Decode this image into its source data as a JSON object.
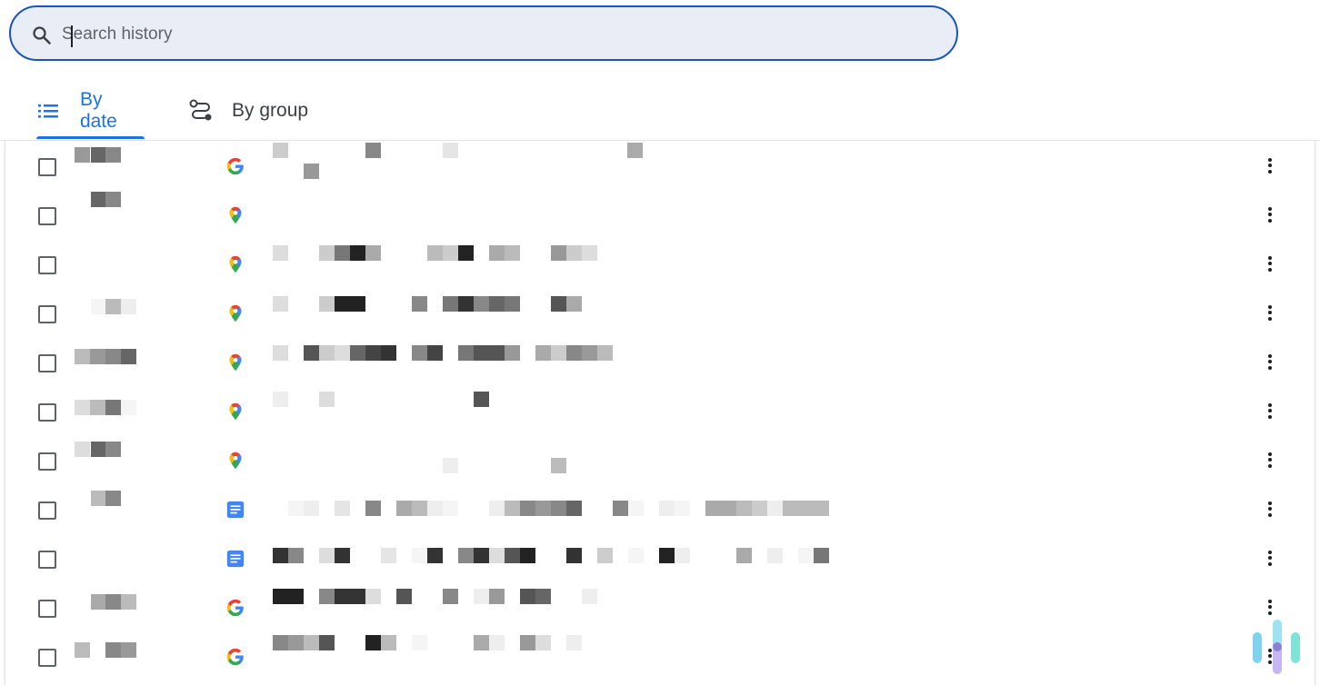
{
  "search": {
    "placeholder": "Search history",
    "icon": "search-icon"
  },
  "tabs": [
    {
      "label": "By date",
      "icon": "list-icon",
      "selected": true
    },
    {
      "label": "By group",
      "icon": "route-icon",
      "selected": false
    }
  ],
  "colors": {
    "accent": "#1a73e8",
    "search_border": "#1a56b8",
    "search_bg": "#e9eef6"
  },
  "rows": [
    {
      "favicon": "google-icon",
      "time_blocks": [
        [
          0,
          8,
          "#999"
        ],
        [
          18,
          8,
          "#666"
        ],
        [
          34,
          8,
          "#888"
        ]
      ],
      "title_blocks": [
        [
          6,
          3,
          "#ccc"
        ],
        [
          40,
          26,
          "#999"
        ],
        [
          108,
          3,
          "#888"
        ],
        [
          193,
          3,
          "#e5e5e5"
        ],
        [
          396,
          3,
          "#aaa"
        ]
      ]
    },
    {
      "favicon": "maps-pin-icon",
      "time_blocks": [
        [
          18,
          3,
          "#666"
        ],
        [
          34,
          3,
          "#888"
        ]
      ],
      "title_blocks": []
    },
    {
      "favicon": "maps-pin-icon",
      "time_blocks": [],
      "title_blocks": [
        [
          6,
          8,
          "#ddd"
        ],
        [
          57,
          8,
          "#ccc"
        ],
        [
          74,
          8,
          "#777"
        ],
        [
          91,
          8,
          "#222"
        ],
        [
          108,
          8,
          "#aaa"
        ],
        [
          176,
          8,
          "#bbb"
        ],
        [
          193,
          8,
          "#ccc"
        ],
        [
          210,
          8,
          "#222"
        ],
        [
          244,
          8,
          "#aaa"
        ],
        [
          261,
          8,
          "#bbb"
        ],
        [
          312,
          8,
          "#999"
        ],
        [
          329,
          8,
          "#ccc"
        ],
        [
          346,
          8,
          "#ddd"
        ]
      ]
    },
    {
      "favicon": "maps-pin-icon",
      "time_blocks": [
        [
          18,
          13,
          "#f5f5f5"
        ],
        [
          34,
          13,
          "#bbb"
        ],
        [
          51,
          13,
          "#eee"
        ]
      ],
      "title_blocks": [
        [
          6,
          10,
          "#ddd"
        ],
        [
          57,
          10,
          "#ccc"
        ],
        [
          74,
          10,
          "#222"
        ],
        [
          91,
          10,
          "#222"
        ],
        [
          159,
          10,
          "#888"
        ],
        [
          193,
          10,
          "#777"
        ],
        [
          210,
          10,
          "#333"
        ],
        [
          227,
          10,
          "#888"
        ],
        [
          244,
          10,
          "#666"
        ],
        [
          261,
          10,
          "#777"
        ],
        [
          312,
          10,
          "#555"
        ],
        [
          329,
          10,
          "#aaa"
        ]
      ]
    },
    {
      "favicon": "maps-pin-icon",
      "time_blocks": [
        [
          0,
          14,
          "#bbb"
        ],
        [
          17,
          14,
          "#999"
        ],
        [
          34,
          14,
          "#888"
        ],
        [
          51,
          14,
          "#666"
        ]
      ],
      "title_blocks": [
        [
          6,
          10,
          "#ddd"
        ],
        [
          40,
          10,
          "#555"
        ],
        [
          57,
          10,
          "#ccc"
        ],
        [
          74,
          10,
          "#ddd"
        ],
        [
          91,
          10,
          "#666"
        ],
        [
          108,
          10,
          "#444"
        ],
        [
          125,
          10,
          "#333"
        ],
        [
          159,
          10,
          "#888"
        ],
        [
          176,
          10,
          "#444"
        ],
        [
          210,
          10,
          "#777"
        ],
        [
          227,
          10,
          "#555"
        ],
        [
          244,
          10,
          "#555"
        ],
        [
          261,
          10,
          "#999"
        ],
        [
          295,
          10,
          "#aaa"
        ],
        [
          312,
          10,
          "#ccc"
        ],
        [
          329,
          10,
          "#888"
        ],
        [
          346,
          10,
          "#999"
        ],
        [
          363,
          10,
          "#bbb"
        ]
      ]
    },
    {
      "favicon": "maps-pin-icon",
      "time_blocks": [
        [
          0,
          16,
          "#ddd"
        ],
        [
          17,
          16,
          "#bbb"
        ],
        [
          34,
          16,
          "#777"
        ],
        [
          51,
          16,
          "#f5f5f5"
        ]
      ],
      "title_blocks": [
        [
          6,
          7,
          "#eee"
        ],
        [
          57,
          7,
          "#ddd"
        ],
        [
          227,
          7,
          "#555"
        ]
      ]
    },
    {
      "favicon": "maps-pin-icon",
      "time_blocks": [
        [
          0,
          8,
          "#ddd"
        ],
        [
          18,
          8,
          "#666"
        ],
        [
          34,
          8,
          "#888"
        ]
      ],
      "title_blocks": [
        [
          193,
          26,
          "#eee"
        ],
        [
          312,
          26,
          "#bbb"
        ]
      ]
    },
    {
      "favicon": "docs-icon",
      "time_blocks": [
        [
          18,
          8,
          "#bbb"
        ],
        [
          34,
          8,
          "#888"
        ]
      ],
      "title_blocks": [
        [
          23,
          19,
          "#f5f5f5"
        ],
        [
          40,
          19,
          "#eee"
        ],
        [
          74,
          19,
          "#e5e5e5"
        ],
        [
          108,
          19,
          "#888"
        ],
        [
          142,
          19,
          "#aaa"
        ],
        [
          159,
          19,
          "#bbb"
        ],
        [
          176,
          19,
          "#eee"
        ],
        [
          193,
          19,
          "#f5f5f5"
        ],
        [
          244,
          19,
          "#eee"
        ],
        [
          261,
          19,
          "#bbb"
        ],
        [
          278,
          19,
          "#888"
        ],
        [
          295,
          19,
          "#999"
        ],
        [
          312,
          19,
          "#888"
        ],
        [
          329,
          19,
          "#666"
        ],
        [
          380,
          19,
          "#888"
        ],
        [
          397,
          19,
          "#f5f5f5"
        ],
        [
          431,
          19,
          "#eee"
        ],
        [
          448,
          19,
          "#f5f5f5"
        ],
        [
          482,
          19,
          "#aaa"
        ],
        [
          499,
          19,
          "#aaa"
        ],
        [
          516,
          19,
          "#bbb"
        ],
        [
          533,
          19,
          "#ccc"
        ],
        [
          550,
          19,
          "#eee"
        ],
        [
          567,
          19,
          "#bbb"
        ],
        [
          584,
          19,
          "#bbb"
        ],
        [
          601,
          19,
          "#bbb"
        ]
      ]
    },
    {
      "favicon": "docs-icon",
      "time_blocks": [],
      "title_blocks": [
        [
          6,
          17,
          "#333"
        ],
        [
          23,
          17,
          "#888"
        ],
        [
          57,
          17,
          "#ddd"
        ],
        [
          74,
          17,
          "#333"
        ],
        [
          125,
          17,
          "#e5e5e5"
        ],
        [
          159,
          17,
          "#f5f5f5"
        ],
        [
          176,
          17,
          "#333"
        ],
        [
          210,
          17,
          "#888"
        ],
        [
          227,
          17,
          "#333"
        ],
        [
          244,
          17,
          "#ddd"
        ],
        [
          261,
          17,
          "#555"
        ],
        [
          278,
          17,
          "#222"
        ],
        [
          329,
          17,
          "#333"
        ],
        [
          363,
          17,
          "#ccc"
        ],
        [
          397,
          17,
          "#f5f5f5"
        ],
        [
          431,
          17,
          "#222"
        ],
        [
          448,
          17,
          "#eee"
        ],
        [
          516,
          17,
          "#aaa"
        ],
        [
          550,
          17,
          "#eee"
        ],
        [
          584,
          17,
          "#f5f5f5"
        ],
        [
          601,
          17,
          "#777"
        ]
      ]
    },
    {
      "favicon": "google-icon",
      "time_blocks": [
        [
          18,
          14,
          "#aaa"
        ],
        [
          34,
          14,
          "#888"
        ],
        [
          51,
          14,
          "#bbb"
        ]
      ],
      "title_blocks": [
        [
          6,
          8,
          "#222"
        ],
        [
          23,
          8,
          "#222"
        ],
        [
          57,
          8,
          "#888"
        ],
        [
          74,
          8,
          "#333"
        ],
        [
          91,
          8,
          "#333"
        ],
        [
          108,
          8,
          "#ddd"
        ],
        [
          142,
          8,
          "#555"
        ],
        [
          193,
          8,
          "#888"
        ],
        [
          227,
          8,
          "#eee"
        ],
        [
          244,
          8,
          "#999"
        ],
        [
          278,
          8,
          "#555"
        ],
        [
          295,
          8,
          "#666"
        ],
        [
          346,
          8,
          "#eee"
        ]
      ]
    },
    {
      "favicon": "google-icon",
      "time_blocks": [
        [
          0,
          13,
          "#bbb"
        ],
        [
          34,
          13,
          "#888"
        ],
        [
          51,
          13,
          "#999"
        ]
      ],
      "title_blocks": [
        [
          6,
          5,
          "#888"
        ],
        [
          23,
          5,
          "#999"
        ],
        [
          40,
          5,
          "#bbb"
        ],
        [
          57,
          5,
          "#555"
        ],
        [
          108,
          5,
          "#222"
        ],
        [
          125,
          5,
          "#bbb"
        ],
        [
          159,
          5,
          "#f5f5f5"
        ],
        [
          227,
          5,
          "#aaa"
        ],
        [
          244,
          5,
          "#eee"
        ],
        [
          278,
          5,
          "#999"
        ],
        [
          295,
          5,
          "#ddd"
        ],
        [
          329,
          5,
          "#eee"
        ]
      ]
    }
  ]
}
